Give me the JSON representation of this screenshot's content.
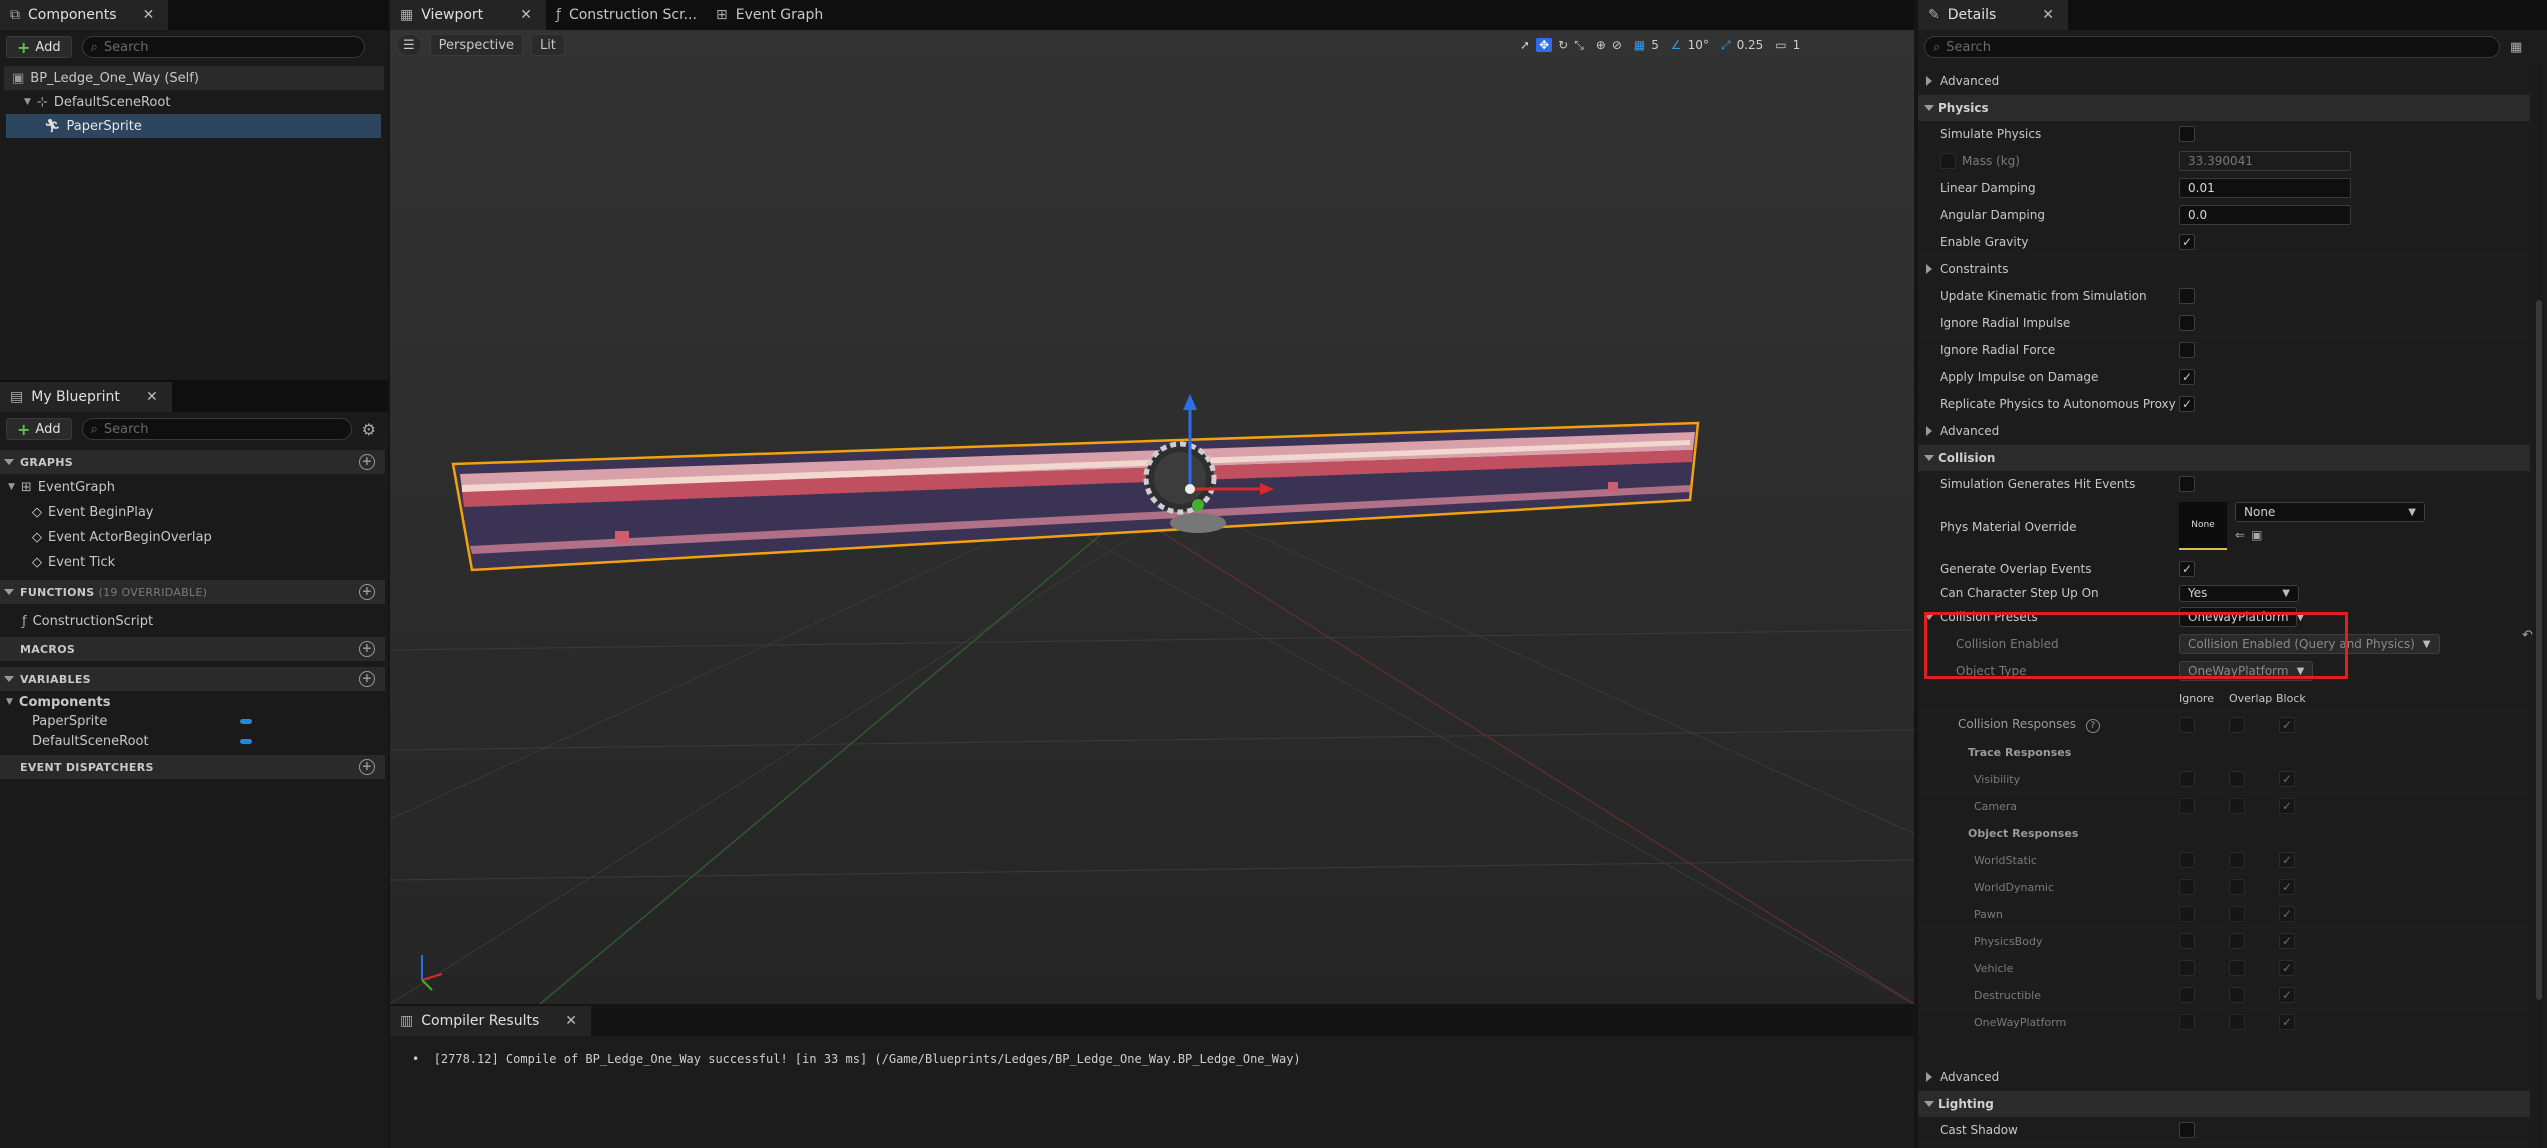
{
  "components_panel": {
    "tab_label": "Components",
    "add_label": "Add",
    "search_placeholder": "Search",
    "tree": [
      "BP_Ledge_One_Way (Self)",
      "DefaultSceneRoot",
      "PaperSprite"
    ]
  },
  "my_blueprint": {
    "tab_label": "My Blueprint",
    "add_label": "Add",
    "search_placeholder": "Search",
    "graphs_label": "GRAPHS",
    "graph_name": "EventGraph",
    "events": [
      "Event BeginPlay",
      "Event ActorBeginOverlap",
      "Event Tick"
    ],
    "functions_label": "FUNCTIONS",
    "functions_count": "(19 OVERRIDABLE)",
    "function_items": [
      "ConstructionScript"
    ],
    "macros_label": "MACROS",
    "variables_label": "VARIABLES",
    "variables_category": "Components",
    "variable_items": [
      "PaperSprite",
      "DefaultSceneRoot"
    ],
    "dispatchers_label": "EVENT DISPATCHERS"
  },
  "editor_tabs": [
    {
      "label": "Viewport"
    },
    {
      "label": "Construction Scr..."
    },
    {
      "label": "Event Graph"
    }
  ],
  "viewport": {
    "view_mode": "Perspective",
    "lighting": "Lit",
    "grid_snap": "5",
    "rot_snap": "10°",
    "scale_snap": "0.25",
    "camera_speed": "1"
  },
  "compiler": {
    "tab_label": "Compiler Results",
    "message": "[2778.12] Compile of BP_Ledge_One_Way successful! [in 33 ms] (/Game/Blueprints/Ledges/BP_Ledge_One_Way.BP_Ledge_One_Way)"
  },
  "details": {
    "tab_label": "Details",
    "search_placeholder": "Search",
    "advanced_label": "Advanced",
    "physics_label": "Physics",
    "physics_rows": {
      "simulate": "Simulate Physics",
      "mass": "Mass (kg)",
      "mass_value": "33.390041",
      "linear": "Linear Damping",
      "linear_value": "0.01",
      "angular": "Angular Damping",
      "angular_value": "0.0",
      "gravity": "Enable Gravity",
      "constraints": "Constraints",
      "kinematic": "Update Kinematic from Simulation",
      "radial_impulse": "Ignore Radial Impulse",
      "radial_force": "Ignore Radial Force",
      "apply_impulse": "Apply Impulse on Damage",
      "replicate": "Replicate Physics to Autonomous Proxy"
    },
    "collision_label": "Collision",
    "collision_rows": {
      "hit_events": "Simulation Generates Hit Events",
      "phys_material": "Phys Material Override",
      "phys_material_thumb": "None",
      "phys_material_value": "None",
      "overlap_events": "Generate Overlap Events",
      "step_up": "Can Character Step Up On",
      "step_up_value": "Yes",
      "presets": "Collision Presets",
      "presets_value": "OneWayPlatform",
      "enabled": "Collision Enabled",
      "enabled_value": "Collision Enabled (Query and Physics)",
      "object_type": "Object Type",
      "object_type_value": "OneWayPlatform",
      "col_ignore": "Ignore",
      "col_overlap": "Overlap",
      "col_block": "Block",
      "responses": "Collision Responses",
      "trace_responses": "Trace Responses",
      "object_responses": "Object Responses"
    },
    "trace_channels": [
      "Visibility",
      "Camera"
    ],
    "object_channels": [
      "WorldStatic",
      "WorldDynamic",
      "Pawn",
      "PhysicsBody",
      "Vehicle",
      "Destructible",
      "OneWayPlatform"
    ],
    "lighting_label": "Lighting",
    "cast_shadow": "Cast Shadow",
    "highlight_color": "#e02020"
  }
}
